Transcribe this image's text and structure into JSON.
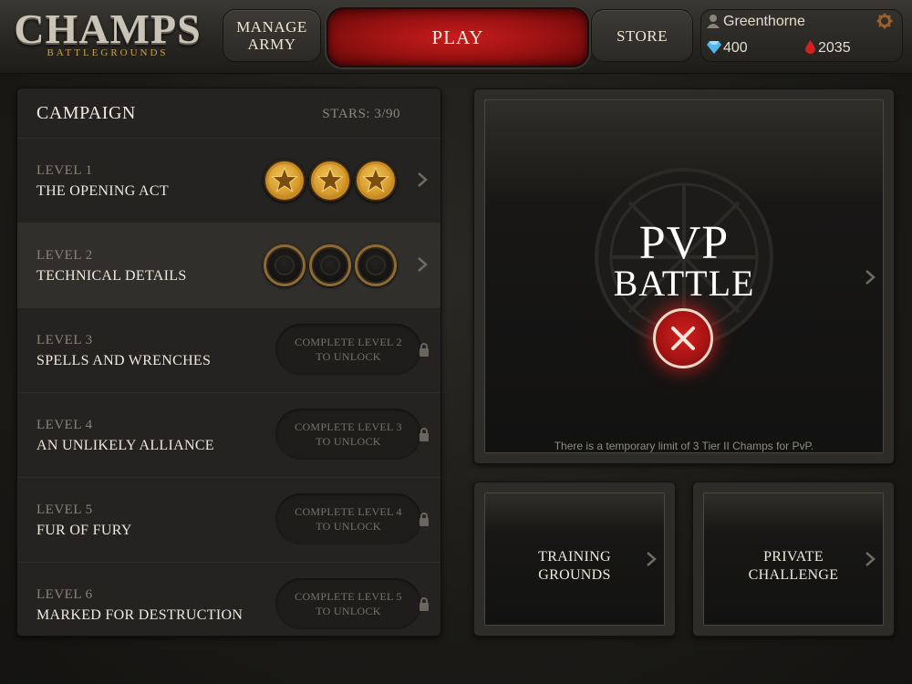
{
  "header": {
    "logo_title": "CHAMPS",
    "logo_subtitle": "BATTLEGROUNDS",
    "manage_army_label": "MANAGE ARMY",
    "play_label": "PLAY",
    "store_label": "STORE",
    "player": {
      "name": "Greenthorne",
      "gems": "400",
      "blood": "2035"
    }
  },
  "campaign": {
    "title": "CAMPAIGN",
    "stars": "STARS: 3/90",
    "levels": [
      {
        "number": "LEVEL 1",
        "name": "THE OPENING ACT",
        "status": "earned-3-stars"
      },
      {
        "number": "LEVEL 2",
        "name": "TECHNICAL DETAILS",
        "status": "no-stars"
      },
      {
        "number": "LEVEL 3",
        "name": "SPELLS AND WRENCHES",
        "lock_text": "COMPLETE LEVEL 2 TO UNLOCK"
      },
      {
        "number": "LEVEL 4",
        "name": "AN UNLIKELY ALLIANCE",
        "lock_text": "COMPLETE LEVEL 3 TO UNLOCK"
      },
      {
        "number": "LEVEL 5",
        "name": "FUR OF FURY",
        "lock_text": "COMPLETE LEVEL 4 TO UNLOCK"
      },
      {
        "number": "LEVEL 6",
        "name": "MARKED FOR DESTRUCTION",
        "lock_text": "COMPLETE LEVEL 5 TO UNLOCK"
      }
    ]
  },
  "pvp": {
    "title_line1": "PVP",
    "title_line2": "BATTLE",
    "note": "There is a temporary limit of 3 Tier II Champs for PvP."
  },
  "training": {
    "label": "TRAINING GROUNDS"
  },
  "private": {
    "label": "PRIVATE CHALLENGE"
  },
  "colors": {
    "play_red": "#a51313",
    "gold_medal": "#d59a2a",
    "gem_blue": "#4fb7f0",
    "blood_red": "#d12222"
  }
}
